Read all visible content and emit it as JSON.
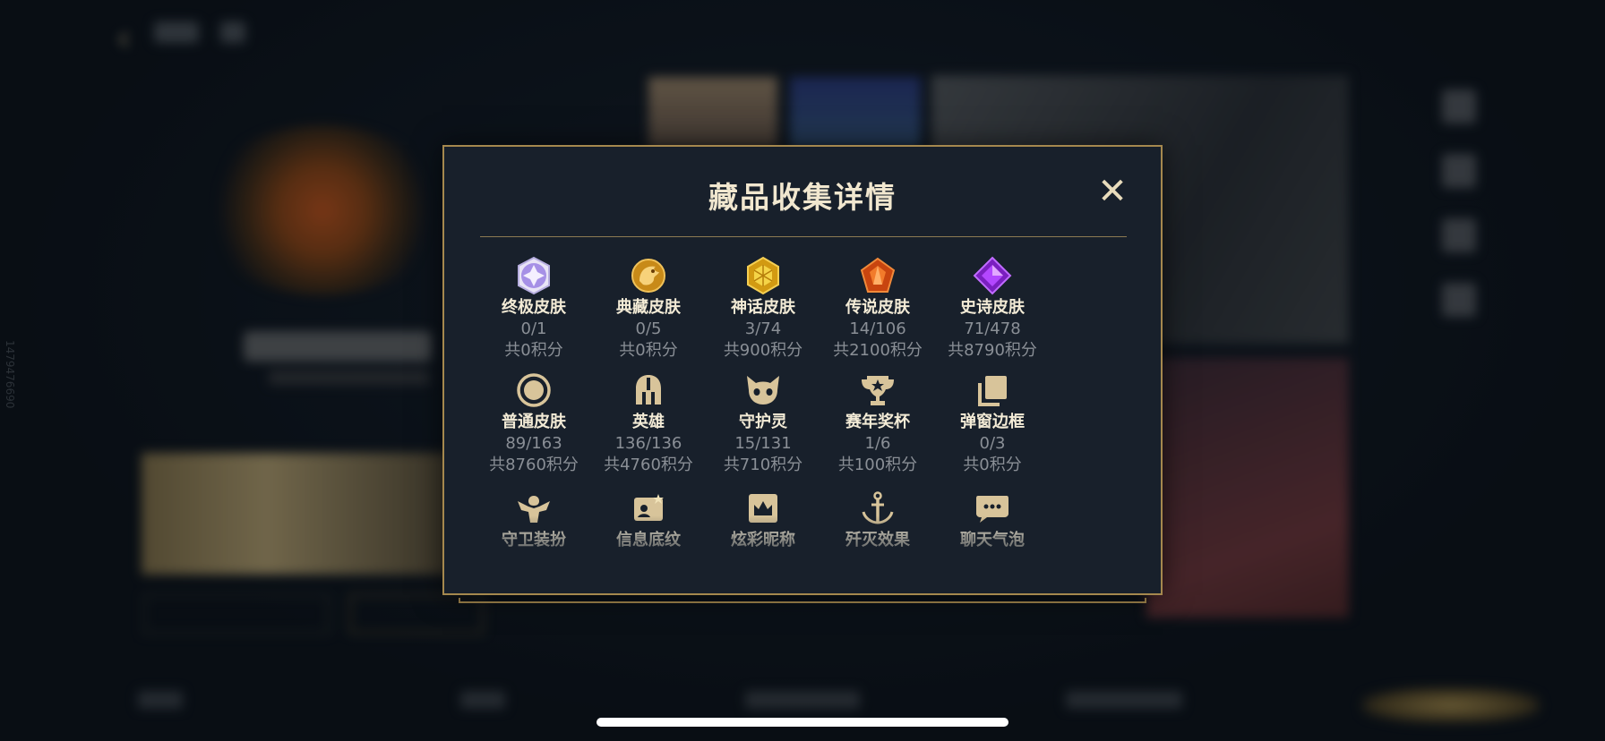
{
  "background": {
    "side_code": "1479476690"
  },
  "modal": {
    "title": "藏品收集详情",
    "close_icon": "close-icon",
    "categories": [
      {
        "icon": "ultimate-skin-icon",
        "name": "终极皮肤",
        "count": "0/1",
        "points": "共0积分"
      },
      {
        "icon": "legacy-skin-icon",
        "name": "典藏皮肤",
        "count": "0/5",
        "points": "共0积分"
      },
      {
        "icon": "mythic-skin-icon",
        "name": "神话皮肤",
        "count": "3/74",
        "points": "共900积分"
      },
      {
        "icon": "legendary-skin-icon",
        "name": "传说皮肤",
        "count": "14/106",
        "points": "共2100积分"
      },
      {
        "icon": "epic-skin-icon",
        "name": "史诗皮肤",
        "count": "71/478",
        "points": "共8790积分"
      },
      {
        "icon": "normal-skin-icon",
        "name": "普通皮肤",
        "count": "89/163",
        "points": "共8760积分"
      },
      {
        "icon": "hero-helmet-icon",
        "name": "英雄",
        "count": "136/136",
        "points": "共4760积分"
      },
      {
        "icon": "guardian-pet-icon",
        "name": "守护灵",
        "count": "15/131",
        "points": "共710积分"
      },
      {
        "icon": "season-trophy-icon",
        "name": "赛年奖杯",
        "count": "1/6",
        "points": "共100积分"
      },
      {
        "icon": "popup-frame-icon",
        "name": "弹窗边框",
        "count": "0/3",
        "points": "共0积分"
      },
      {
        "icon": "guardian-costume-icon",
        "name": "守卫装扮",
        "count": "",
        "points": ""
      },
      {
        "icon": "info-background-icon",
        "name": "信息底纹",
        "count": "",
        "points": ""
      },
      {
        "icon": "colorful-nickname-icon",
        "name": "炫彩昵称",
        "count": "",
        "points": ""
      },
      {
        "icon": "annihilation-effect-icon",
        "name": "歼灭效果",
        "count": "",
        "points": ""
      },
      {
        "icon": "chat-bubble-icon",
        "name": "聊天气泡",
        "count": "",
        "points": ""
      }
    ]
  },
  "colors": {
    "modal_bg": "#18202b",
    "modal_border": "#a5884e",
    "title_text": "#f1e7cf",
    "sub_text": "#8a8f96",
    "icon_gold": "#d8c49a"
  }
}
